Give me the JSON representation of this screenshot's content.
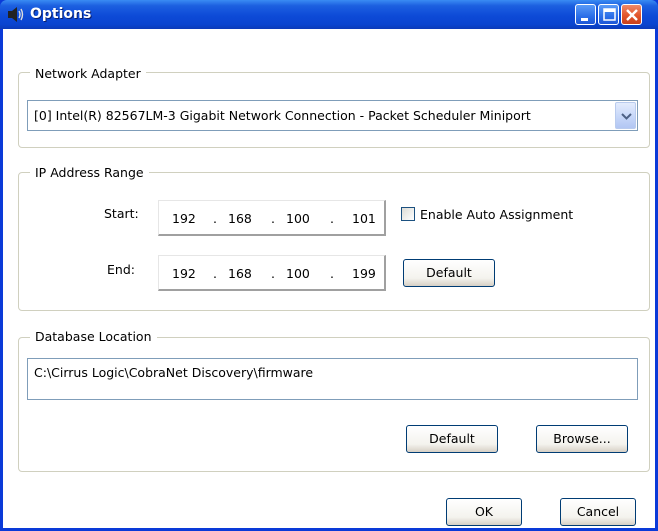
{
  "window": {
    "title": "Options",
    "icon": "speaker-icon"
  },
  "network_adapter": {
    "label": "Network Adapter",
    "selected": "[0] Intel(R) 82567LM-3 Gigabit Network Connection - Packet Scheduler Miniport"
  },
  "ip_range": {
    "label": "IP Address Range",
    "start_label": "Start:",
    "end_label": "End:",
    "start": [
      "192",
      "168",
      "100",
      "101"
    ],
    "end": [
      "192",
      "168",
      "100",
      "199"
    ],
    "separator": ".",
    "auto_assign_label": "Enable Auto Assignment",
    "auto_assign_checked": false,
    "default_label": "Default"
  },
  "database": {
    "label": "Database Location",
    "path": "C:\\Cirrus Logic\\CobraNet Discovery\\firmware",
    "default_label": "Default",
    "browse_label": "Browse..."
  },
  "footer": {
    "ok_label": "OK",
    "cancel_label": "Cancel"
  }
}
